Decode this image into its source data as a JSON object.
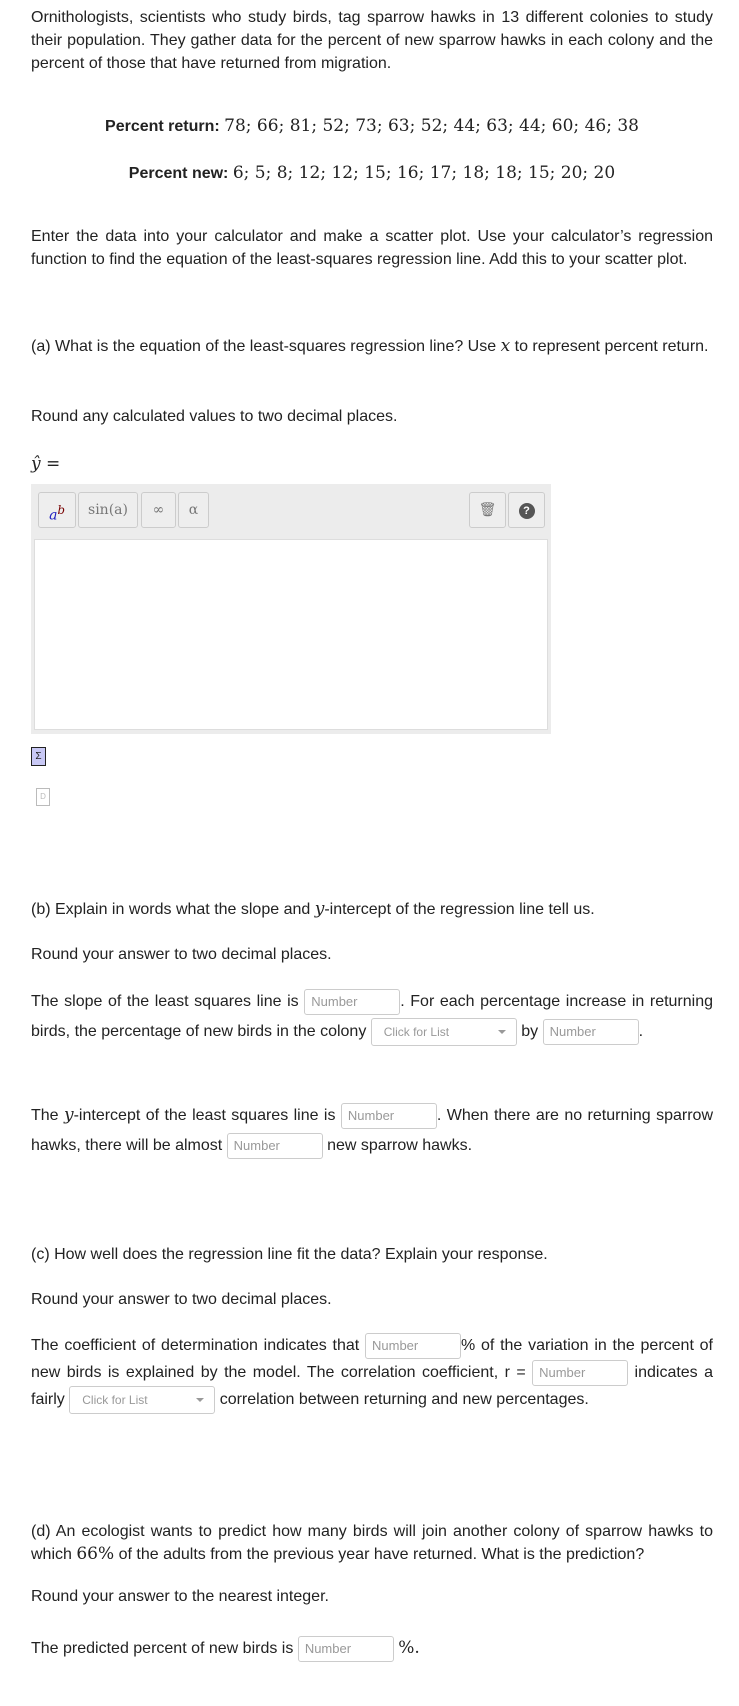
{
  "intro": "Ornithologists, scientists who study birds, tag sparrow hawks in 13 different colonies to study their population. They gather data for the percent of new sparrow hawks in each colony and the percent of those that have returned from migration.",
  "data_rows": [
    {
      "label": "Percent return:",
      "values": "78; 66; 81; 52; 73; 63; 52; 44; 63; 44; 60; 46; 38"
    },
    {
      "label": "Percent new:",
      "values": "6; 5; 8; 12; 12; 15; 16; 17; 18; 18; 15; 20; 20"
    }
  ],
  "instructions": "Enter the data into your calculator and make a scatter plot. Use your calculator’s regression function to find the equation of the least-squares regression line. Add this to your scatter plot.",
  "part_a": {
    "question_pre": "(a) What is the equation of the least-squares regression line? Use ",
    "var": "x",
    "question_post": " to represent percent return.",
    "round": "Round any calculated values to two decimal places.",
    "yhat": "ŷ =",
    "toolbar": {
      "power": "ab",
      "sin": "sin(a)",
      "infinity": "∞",
      "alpha": "α"
    }
  },
  "part_b": {
    "question_pre": "(b) Explain in words what the slope and ",
    "var": "y",
    "question_post": "-intercept of the regression line tell us.",
    "round": "Round your answer to two decimal places.",
    "s1": "The slope of the least squares line is",
    "s2": ". For each percentage increase in returning birds, the percentage of new birds in the colony",
    "s3": "by",
    "s4": ".",
    "t1": "The ",
    "t1b": "-intercept of the least squares line is",
    "t2": ". When there are no returning sparrow hawks, there will be almost",
    "t3": "new sparrow hawks."
  },
  "part_c": {
    "question": "(c) How well does the regression line fit the data? Explain your response.",
    "round": "Round your answer to two decimal places.",
    "s1": "The coefficient of determination indicates that",
    "s2": "% of the variation in the percent of new birds is explained by the model. The correlation coefficient, r =",
    "s3": "indicates a fairly",
    "s4": "correlation between returning and new percentages."
  },
  "part_d": {
    "question_pre": "(d) An ecologist wants to predict how many birds will join another colony of sparrow hawks to which ",
    "pct": "66%",
    "question_post": " of the adults from the previous year have returned. What is the prediction?",
    "round": "Round your answer to the nearest integer.",
    "s1": "The predicted percent of new birds is",
    "s2": "%."
  },
  "placeholders": {
    "number": "Number",
    "list": "Click for List"
  }
}
